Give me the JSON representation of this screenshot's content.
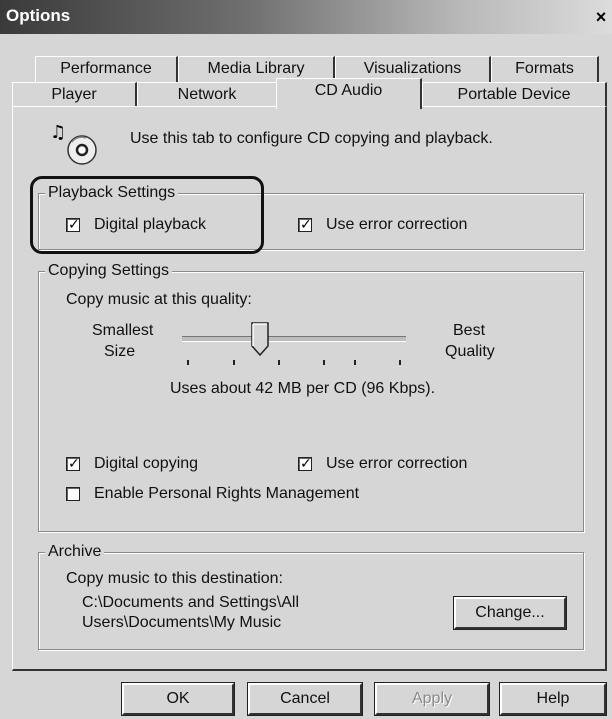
{
  "window": {
    "title": "Options",
    "close_glyph": "×"
  },
  "tabs": {
    "row1": [
      "Performance",
      "Media Library",
      "Visualizations",
      "Formats"
    ],
    "row2": [
      "Player",
      "Network",
      "CD Audio",
      "Portable Device"
    ],
    "active": "CD Audio"
  },
  "intro": {
    "icon": "cd-audio-icon",
    "text": "Use this tab to configure CD copying and playback."
  },
  "playback": {
    "legend": "Playback Settings",
    "digital_playback": {
      "label": "Digital playback",
      "checked": true
    },
    "error_correction": {
      "label": "Use error correction",
      "checked": true
    }
  },
  "copying": {
    "legend": "Copying Settings",
    "quality_label": "Copy music at this quality:",
    "slider_min_line1": "Smallest",
    "slider_min_line2": "Size",
    "slider_max_line1": "Best",
    "slider_max_line2": "Quality",
    "quality_info": "Uses about 42 MB per CD (96 Kbps).",
    "digital_copying": {
      "label": "Digital copying",
      "checked": true
    },
    "error_correction": {
      "label": "Use error correction",
      "checked": true
    },
    "prm": {
      "label": "Enable Personal Rights Management",
      "checked": false
    }
  },
  "archive": {
    "legend": "Archive",
    "destination_label": "Copy music to this destination:",
    "path_line1": "C:\\Documents and Settings\\All",
    "path_line2": "Users\\Documents\\My Music",
    "change_button": "Change..."
  },
  "buttons": {
    "ok": "OK",
    "cancel": "Cancel",
    "apply": "Apply",
    "help": "Help"
  },
  "check_glyph": "✓"
}
